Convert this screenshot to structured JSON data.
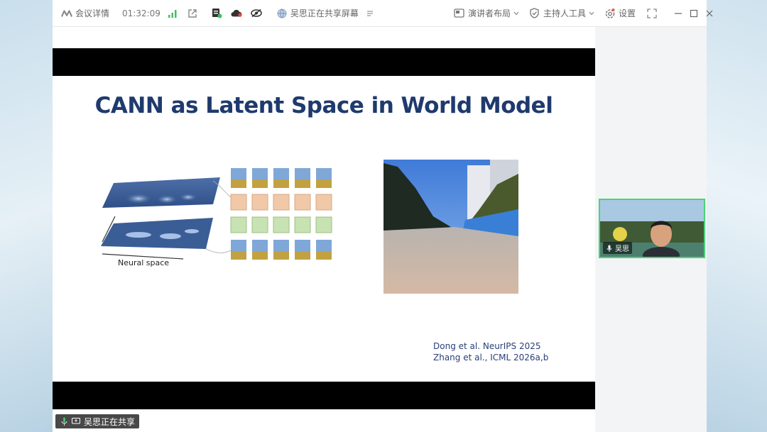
{
  "toolbar": {
    "meeting_details": "会议详情",
    "elapsed_time": "01:32:09",
    "sharing_status": "吴思正在共享屏幕",
    "presenter_layout": "演讲者布局",
    "host_tools": "主持人工具",
    "settings": "设置"
  },
  "slide": {
    "title": "CANN as Latent Space in World Model",
    "figure_label": "Neural space",
    "references": [
      "Dong et al. NeurIPS 2025",
      "Zhang et al., ICML 2026a,b"
    ]
  },
  "participant": {
    "name": "吴思"
  },
  "share_indicator": {
    "label": "吴思正在共享"
  },
  "colors": {
    "title_blue": "#1f3a6d",
    "active_speaker_border": "#4cd07a",
    "signal_green": "#3fbf5f"
  }
}
